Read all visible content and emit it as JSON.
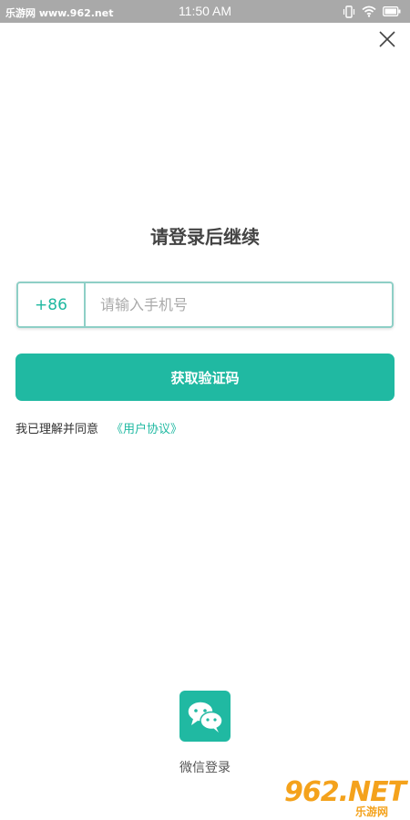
{
  "status_bar": {
    "site_label": "乐游网 www.962.net",
    "time": "11:50 AM"
  },
  "page": {
    "title": "请登录后继续"
  },
  "phone_form": {
    "country_code": "+86",
    "phone_value": "",
    "phone_placeholder": "请输入手机号"
  },
  "actions": {
    "get_code_label": "获取验证码"
  },
  "agreement": {
    "prefix": "我已理解并同意",
    "link_label": "《用户协议》"
  },
  "wechat_login": {
    "label": "微信登录"
  },
  "watermark": {
    "main": "962.NET",
    "sub": "乐游网"
  },
  "colors": {
    "accent": "#20b9a2",
    "input_border": "#8ecfc6",
    "status_bar": "#a9a9a9"
  },
  "icons": {
    "close": "close-icon",
    "wechat": "wechat-icon",
    "vibrate": "vibrate-icon",
    "wifi": "wifi-icon",
    "battery": "battery-icon"
  }
}
